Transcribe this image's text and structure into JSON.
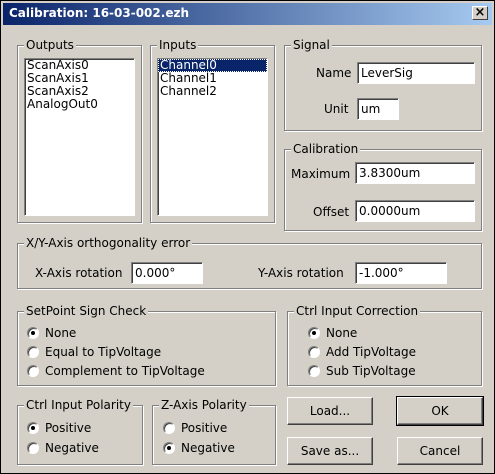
{
  "window": {
    "title": "Calibration: 16-03-002.ezh",
    "close_glyph": "×"
  },
  "outputs": {
    "label": "Outputs",
    "items": [
      "ScanAxis0",
      "ScanAxis1",
      "ScanAxis2",
      "AnalogOut0"
    ]
  },
  "inputs": {
    "label": "Inputs",
    "items": [
      "Channel0",
      "Channel1",
      "Channel2"
    ],
    "selected": "Channel0"
  },
  "signal": {
    "label": "Signal",
    "name_label": "Name",
    "name_value": "LeverSig",
    "unit_label": "Unit",
    "unit_value": "um"
  },
  "calibration": {
    "label": "Calibration",
    "max_label": "Maximum",
    "max_value": "3.8300um",
    "offset_label": "Offset",
    "offset_value": "0.0000um"
  },
  "ortho": {
    "label": "X/Y-Axis orthogonality error",
    "x_label": "X-Axis rotation",
    "x_value": "0.000°",
    "y_label": "Y-Axis rotation",
    "y_value": "-1.000°"
  },
  "setpoint": {
    "label": "SetPoint Sign Check",
    "options": [
      "None",
      "Equal to TipVoltage",
      "Complement to TipVoltage"
    ],
    "selected": "None"
  },
  "ctrl_correction": {
    "label": "Ctrl Input Correction",
    "options": [
      "None",
      "Add TipVoltage",
      "Sub TipVoltage"
    ],
    "selected": "None"
  },
  "ctrl_polarity": {
    "label": "Ctrl Input Polarity",
    "options": [
      "Positive",
      "Negative"
    ],
    "selected": "Positive"
  },
  "z_polarity": {
    "label": "Z-Axis Polarity",
    "options": [
      "Positive",
      "Negative"
    ],
    "selected": "Negative"
  },
  "buttons": {
    "load": "Load...",
    "ok": "OK",
    "save_as": "Save as...",
    "cancel": "Cancel"
  }
}
